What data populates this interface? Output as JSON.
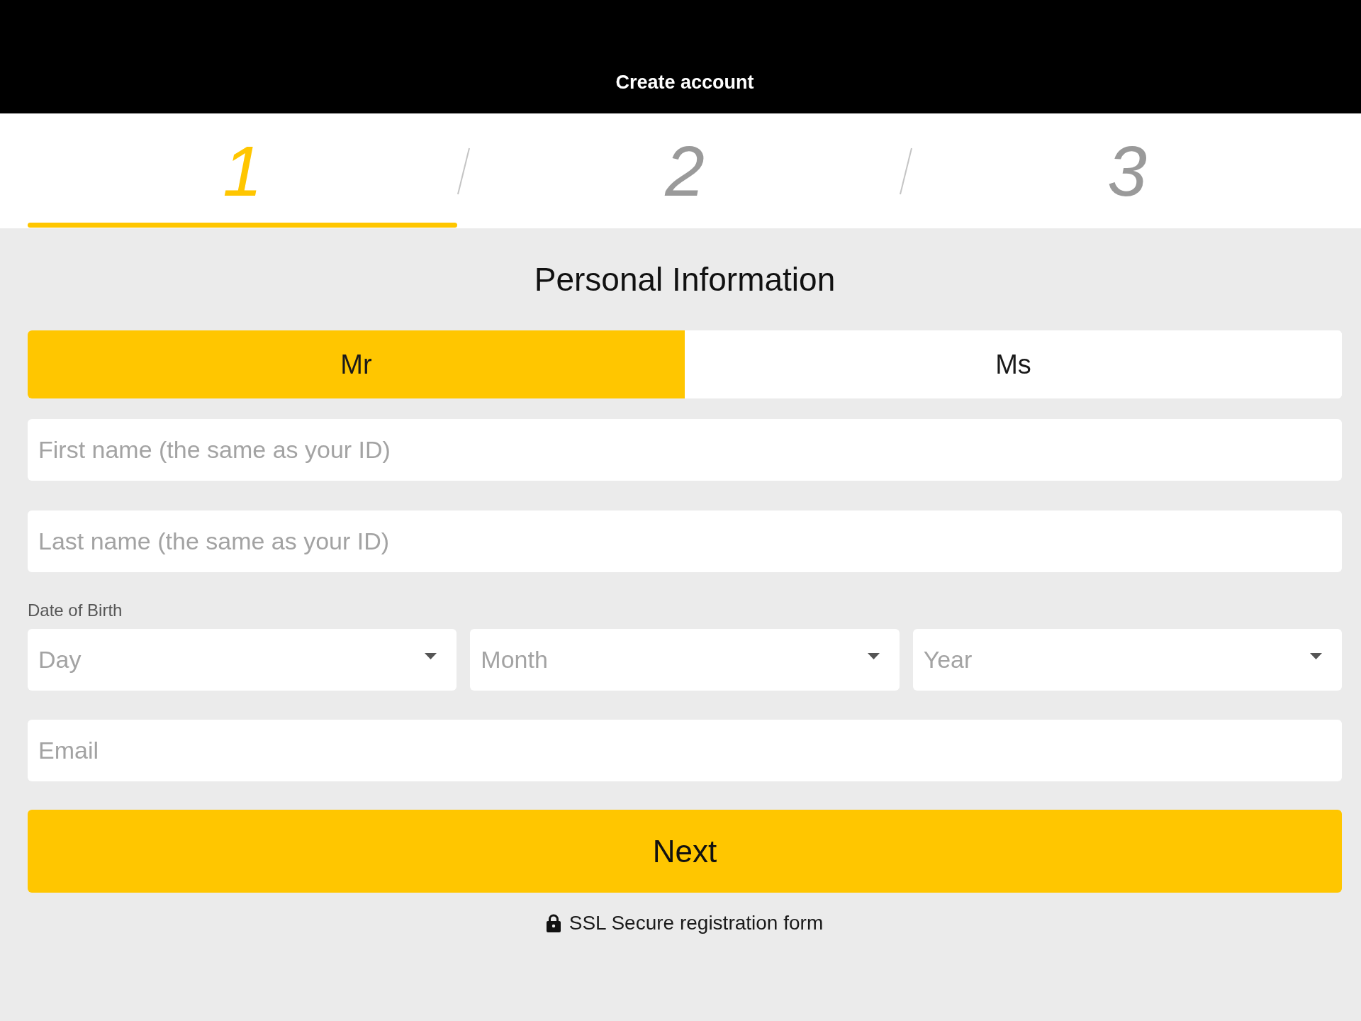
{
  "header": {
    "title": "Create account"
  },
  "steps": [
    {
      "label": "1",
      "selected": true
    },
    {
      "label": "2",
      "selected": false
    },
    {
      "label": "3",
      "selected": false
    }
  ],
  "section_title": "Personal Information",
  "salutation": [
    {
      "label": "Mr",
      "selected": true
    },
    {
      "label": "Ms",
      "selected": false
    }
  ],
  "name_fields": [
    {
      "placeholder": "First name (the same as your ID)"
    },
    {
      "placeholder": "Last name (the same as your ID)"
    }
  ],
  "date_of_birth": {
    "label": "Date of Birth",
    "selects": [
      {
        "placeholder": "Day"
      },
      {
        "placeholder": "Month"
      },
      {
        "placeholder": "Year"
      }
    ]
  },
  "email": {
    "placeholder": "Email"
  },
  "next_button": {
    "label": "Next"
  },
  "security_note": {
    "text": "SSL Secure registration form"
  }
}
